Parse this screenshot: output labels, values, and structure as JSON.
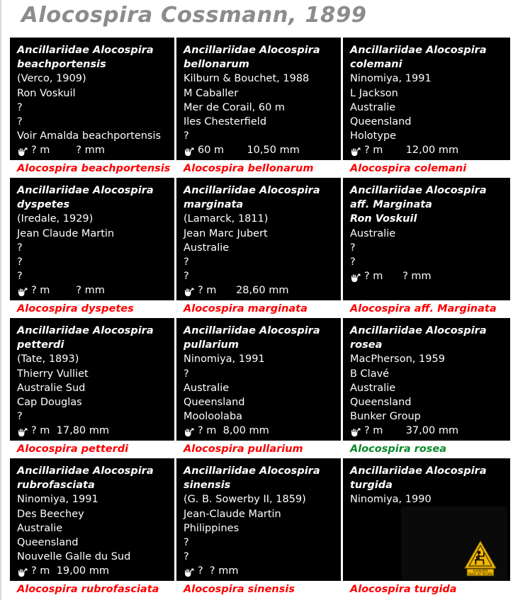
{
  "header": {
    "title": "Alocospira Cossmann, 1899",
    "title_color": "#8c8c8c"
  },
  "colors": {
    "card_background": "#000000",
    "card_text": "#ffffff",
    "caption_red": "#ff0000",
    "caption_green": "#0a8a2a",
    "page_background": "#ffffff"
  },
  "icons": {
    "depth_icon_name": "hand-icon",
    "warning_icon_name": "danger-man-at-work-icon",
    "warning_top_text": "DANGER",
    "warning_bottom_text": "MAN AT WORK"
  },
  "cards": [
    {
      "lines": [
        {
          "text": "Ancillariidae Alocospira",
          "italic": true
        },
        {
          "text": "beachportensis",
          "italic": true
        },
        {
          "text": "(Verco, 1909)",
          "italic": false
        },
        {
          "text": "Ron Voskuil",
          "italic": false
        },
        {
          "text": "?",
          "italic": false
        },
        {
          "text": "?",
          "italic": false
        },
        {
          "text": "Voir Amalda beachportensis",
          "italic": false
        }
      ],
      "depth": "? m",
      "size": "? mm",
      "measure_text": "? m        ? mm",
      "caption": "Alocospira beachportensis",
      "caption_color": "#ff0000",
      "has_warning_image": false
    },
    {
      "lines": [
        {
          "text": "Ancillariidae Alocospira",
          "italic": true
        },
        {
          "text": "bellonarum",
          "italic": true
        },
        {
          "text": "Kilburn & Bouchet, 1988",
          "italic": false
        },
        {
          "text": "M Caballer",
          "italic": false
        },
        {
          "text": "Mer de Corail, 60 m",
          "italic": false
        },
        {
          "text": "Iles Chesterfield",
          "italic": false
        },
        {
          "text": "?",
          "italic": false
        }
      ],
      "depth": "60 m",
      "size": "10,50 mm",
      "measure_text": "60 m       10,50 mm",
      "caption": "Alocospira bellonarum",
      "caption_color": "#ff0000",
      "has_warning_image": false
    },
    {
      "lines": [
        {
          "text": "Ancillariidae Alocospira",
          "italic": true
        },
        {
          "text": "colemani",
          "italic": true
        },
        {
          "text": "Ninomiya, 1991",
          "italic": false
        },
        {
          "text": "L Jackson",
          "italic": false
        },
        {
          "text": "Australie",
          "italic": false
        },
        {
          "text": "Queensland",
          "italic": false
        },
        {
          "text": "Holotype",
          "italic": false
        }
      ],
      "depth": "? m",
      "size": "12,00 mm",
      "measure_text": "? m       12,00 mm",
      "caption": "Alocospira colemani",
      "caption_color": "#ff0000",
      "has_warning_image": false
    },
    {
      "lines": [
        {
          "text": "Ancillariidae Alocospira",
          "italic": true
        },
        {
          "text": "dyspetes",
          "italic": true
        },
        {
          "text": "(Iredale, 1929)",
          "italic": false
        },
        {
          "text": "Jean Claude Martin",
          "italic": false
        },
        {
          "text": "?",
          "italic": false
        },
        {
          "text": "?",
          "italic": false
        },
        {
          "text": "?",
          "italic": false
        }
      ],
      "depth": "? m",
      "size": "? mm",
      "measure_text": "? m        ? mm",
      "caption": "Alocospira dyspetes",
      "caption_color": "#ff0000",
      "has_warning_image": false
    },
    {
      "lines": [
        {
          "text": "Ancillariidae Alocospira",
          "italic": true
        },
        {
          "text": "marginata",
          "italic": true
        },
        {
          "text": "(Lamarck, 1811)",
          "italic": false
        },
        {
          "text": "Jean Marc Jubert",
          "italic": false
        },
        {
          "text": "Australie",
          "italic": false
        },
        {
          "text": "?",
          "italic": false
        },
        {
          "text": "?",
          "italic": false
        }
      ],
      "depth": "? m",
      "size": "28,60 mm",
      "measure_text": "? m      28,60 mm",
      "caption": "Alocospira marginata",
      "caption_color": "#ff0000",
      "has_warning_image": false
    },
    {
      "lines": [
        {
          "text": "Ancillariidae Alocospira",
          "italic": true
        },
        {
          "text": "aff. Marginata",
          "italic": true
        },
        {
          "text": "",
          "italic": false
        },
        {
          "text": "Ron Voskuil",
          "italic": true
        },
        {
          "text": "Australie",
          "italic": false
        },
        {
          "text": "?",
          "italic": false
        },
        {
          "text": "?",
          "italic": false
        }
      ],
      "depth": "? m",
      "size": "? mm",
      "measure_text": "? m      ? mm",
      "caption": "Alocospira aff. Marginata",
      "caption_color": "#ff0000",
      "has_warning_image": false
    },
    {
      "lines": [
        {
          "text": "Ancillariidae Alocospira",
          "italic": true
        },
        {
          "text": "petterdi",
          "italic": true
        },
        {
          "text": "(Tate, 1893)",
          "italic": false
        },
        {
          "text": "Thierry Vulliet",
          "italic": false
        },
        {
          "text": "Australie Sud",
          "italic": false
        },
        {
          "text": "Cap Douglas",
          "italic": false
        },
        {
          "text": "?",
          "italic": false
        }
      ],
      "depth": "? m",
      "size": "17,80 mm",
      "measure_text": "? m  17,80 mm",
      "caption": "Alocospira petterdi",
      "caption_color": "#ff0000",
      "has_warning_image": false
    },
    {
      "lines": [
        {
          "text": "Ancillariidae Alocospira",
          "italic": true
        },
        {
          "text": "pullarium",
          "italic": true
        },
        {
          "text": "Ninomiya, 1991",
          "italic": false
        },
        {
          "text": "?",
          "italic": false
        },
        {
          "text": "Australie",
          "italic": false
        },
        {
          "text": "Queensland",
          "italic": false
        },
        {
          "text": "Mooloolaba",
          "italic": false
        }
      ],
      "depth": "? m",
      "size": "8,00 mm",
      "measure_text": "? m  8,00 mm",
      "caption": "Alocospira pullarium",
      "caption_color": "#ff0000",
      "has_warning_image": false
    },
    {
      "lines": [
        {
          "text": "Ancillariidae Alocospira",
          "italic": true
        },
        {
          "text": "rosea",
          "italic": true
        },
        {
          "text": "MacPherson, 1959",
          "italic": false
        },
        {
          "text": "B Clavé",
          "italic": false
        },
        {
          "text": "Australie",
          "italic": false
        },
        {
          "text": "Queensland",
          "italic": false
        },
        {
          "text": "Bunker Group",
          "italic": false
        }
      ],
      "depth": "? m",
      "size": "37,00 mm",
      "measure_text": "? m       37,00 mm",
      "caption": "Alocospira rosea",
      "caption_color": "#0a8a2a",
      "has_warning_image": false
    },
    {
      "lines": [
        {
          "text": "Ancillariidae Alocospira",
          "italic": true
        },
        {
          "text": "rubrofasciata",
          "italic": true
        },
        {
          "text": "Ninomiya, 1991",
          "italic": false
        },
        {
          "text": "Des Beechey",
          "italic": false
        },
        {
          "text": "Australie",
          "italic": false
        },
        {
          "text": "Queensland",
          "italic": false
        },
        {
          "text": "Nouvelle Galle du Sud",
          "italic": false
        }
      ],
      "depth": "? m",
      "size": "19,00 mm",
      "measure_text": "? m  19,00 mm",
      "caption": "Alocospira rubrofasciata",
      "caption_color": "#ff0000",
      "has_warning_image": false
    },
    {
      "lines": [
        {
          "text": "Ancillariidae Alocospira",
          "italic": true
        },
        {
          "text": "sinensis",
          "italic": true
        },
        {
          "text": "(G. B. Sowerby II, 1859)",
          "italic": false
        },
        {
          "text": "Jean-Claude Martin",
          "italic": false
        },
        {
          "text": "Philippines",
          "italic": false
        },
        {
          "text": "?",
          "italic": false
        },
        {
          "text": "?",
          "italic": false
        }
      ],
      "depth": "?",
      "size": "? mm",
      "measure_text": "?  ? mm",
      "caption": "Alocospira sinensis",
      "caption_color": "#ff0000",
      "has_warning_image": false
    },
    {
      "lines": [
        {
          "text": "Ancillariidae Alocospira",
          "italic": true
        },
        {
          "text": "turgida",
          "italic": true
        },
        {
          "text": "Ninomiya, 1990",
          "italic": false
        }
      ],
      "depth": "",
      "size": "",
      "measure_text": "",
      "caption": "Alocospira turgida",
      "caption_color": "#ff0000",
      "has_warning_image": true
    }
  ]
}
